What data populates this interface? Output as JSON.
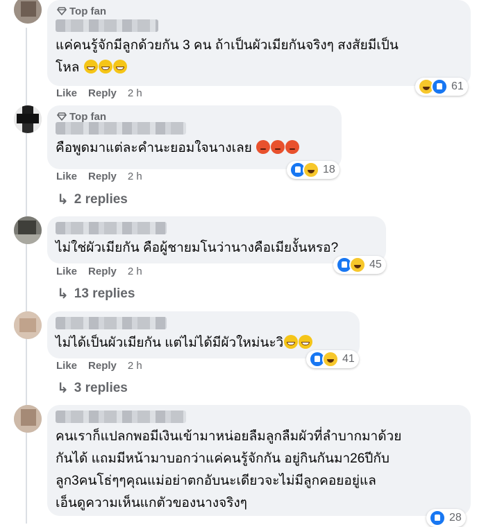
{
  "badge": {
    "label": "Top fan"
  },
  "actions": {
    "like": "Like",
    "reply": "Reply"
  },
  "comments": [
    {
      "top_fan": true,
      "lines": [
        "แค่คนรู้จักมีลูกด้วยกัน 3 คน ถ้าเป็นผัวเมียกันจริงๆ สงสัยมีเป็น",
        "โหล"
      ],
      "time": "2 h",
      "reaction_count": "61",
      "reaction_icons": [
        "haha",
        "like"
      ]
    },
    {
      "top_fan": true,
      "lines": [
        "คือพูดมาแต่ละคำนะยอมใจนางเลย"
      ],
      "time": "2 h",
      "reaction_count": "18",
      "reaction_icons": [
        "like",
        "haha"
      ],
      "replies": "2 replies"
    },
    {
      "top_fan": false,
      "lines": [
        "ไม่ใช่ผัวเมียกัน คือผู้ชายมโนว่านางคือเมียงั้นหรอ?"
      ],
      "time": "2 h",
      "reaction_count": "45",
      "reaction_icons": [
        "like",
        "haha"
      ],
      "replies": "13 replies"
    },
    {
      "top_fan": false,
      "lines": [
        "ไม่ได้เป็นผัวเมียกัน แต่ไม่ได้มีผัวใหม่นะวิ"
      ],
      "time": "2 h",
      "reaction_count": "41",
      "reaction_icons": [
        "like",
        "haha"
      ],
      "replies": "3 replies"
    },
    {
      "top_fan": false,
      "lines": [
        "คนเราก็แปลกพอมีเงินเข้ามาหน่อยลืมลูกลืมผัวที่ลำบากมาด้วย",
        "กันได้ แถมมีหน้ามาบอกว่าแค่คนรู้จักกัน อยู่กินกันมา26ปีกับ",
        "ลูก3คนโธ่ๆๆคุณแม่อย่าตกอับนะเดียวจะไม่มีลูกคอยอยู่แล",
        "เอ็นดูความเห็นแกตัวของนางจริงๆ"
      ],
      "reaction_count": "28",
      "reaction_icons": [
        "like"
      ]
    }
  ]
}
